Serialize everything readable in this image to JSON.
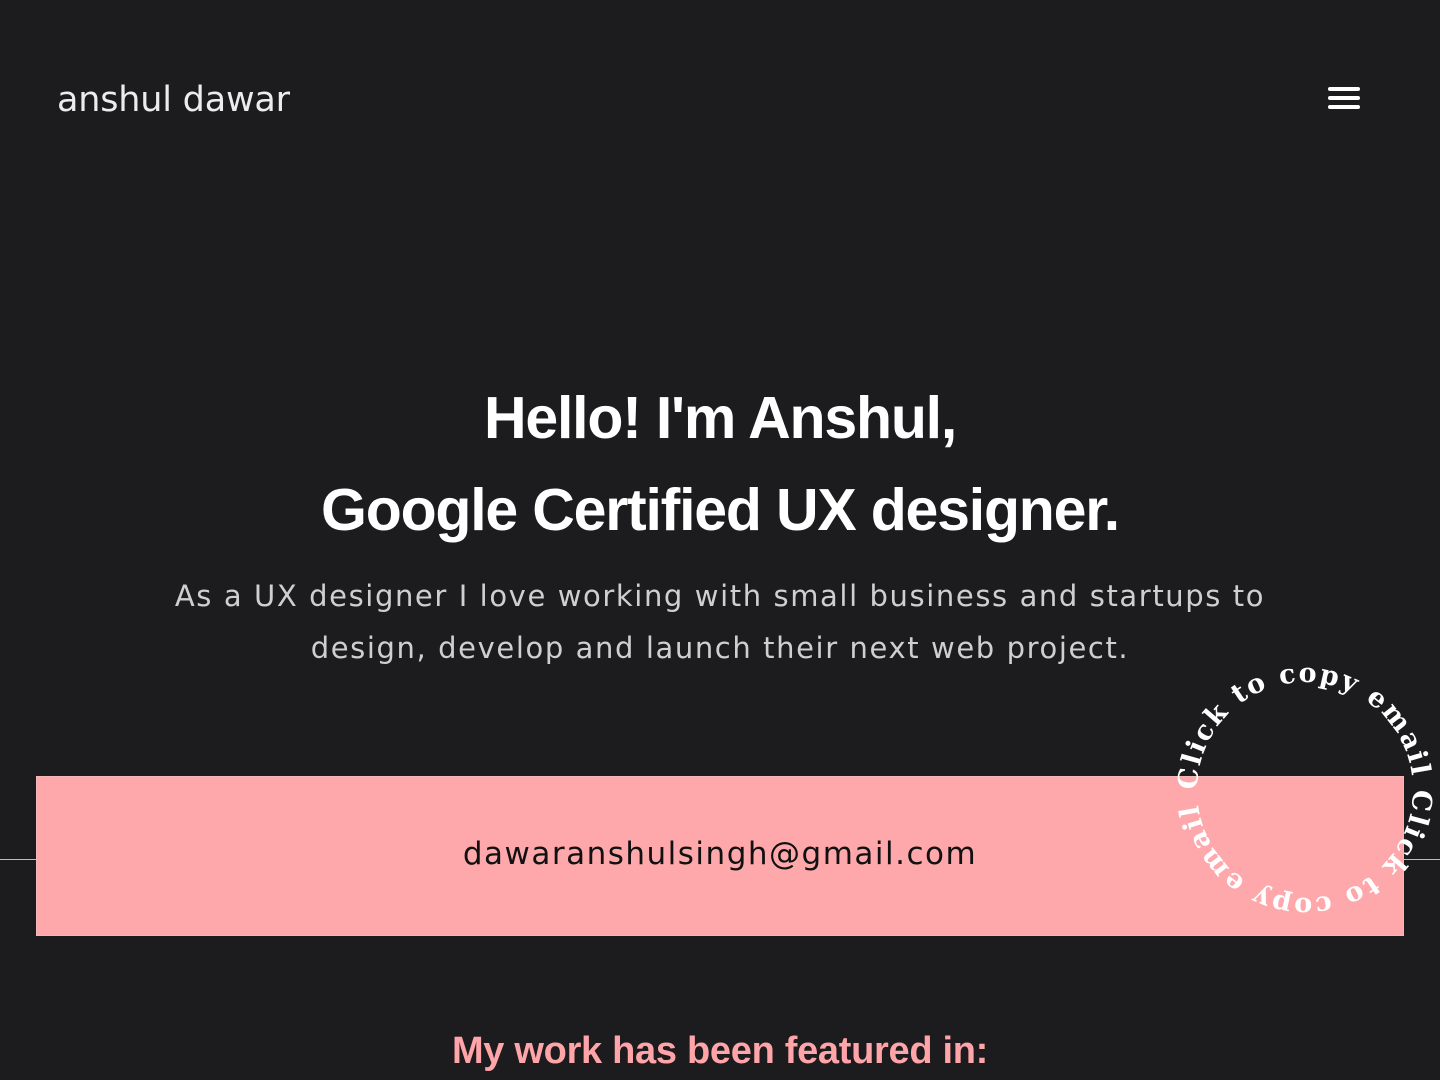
{
  "header": {
    "logo_text": "anshul dawar",
    "menu_icon": "hamburger-menu-icon"
  },
  "hero": {
    "title_line1": "Hello! I'm Anshul,",
    "title_line2": "Google Certified UX designer.",
    "subtitle_line1": "As a UX designer I love working with small business and startups to",
    "subtitle_line2": "design, develop and launch their next web project."
  },
  "contact": {
    "email": "dawaranshulsingh@gmail.com",
    "copy_badge_text": "Click to copy email Click to copy email"
  },
  "featured": {
    "heading": "My work has been featured in:"
  },
  "colors": {
    "background": "#1c1b1e",
    "accent_pink": "#ffa8ac",
    "heading_pink": "#ffa4a8",
    "text_white": "#ffffff"
  }
}
